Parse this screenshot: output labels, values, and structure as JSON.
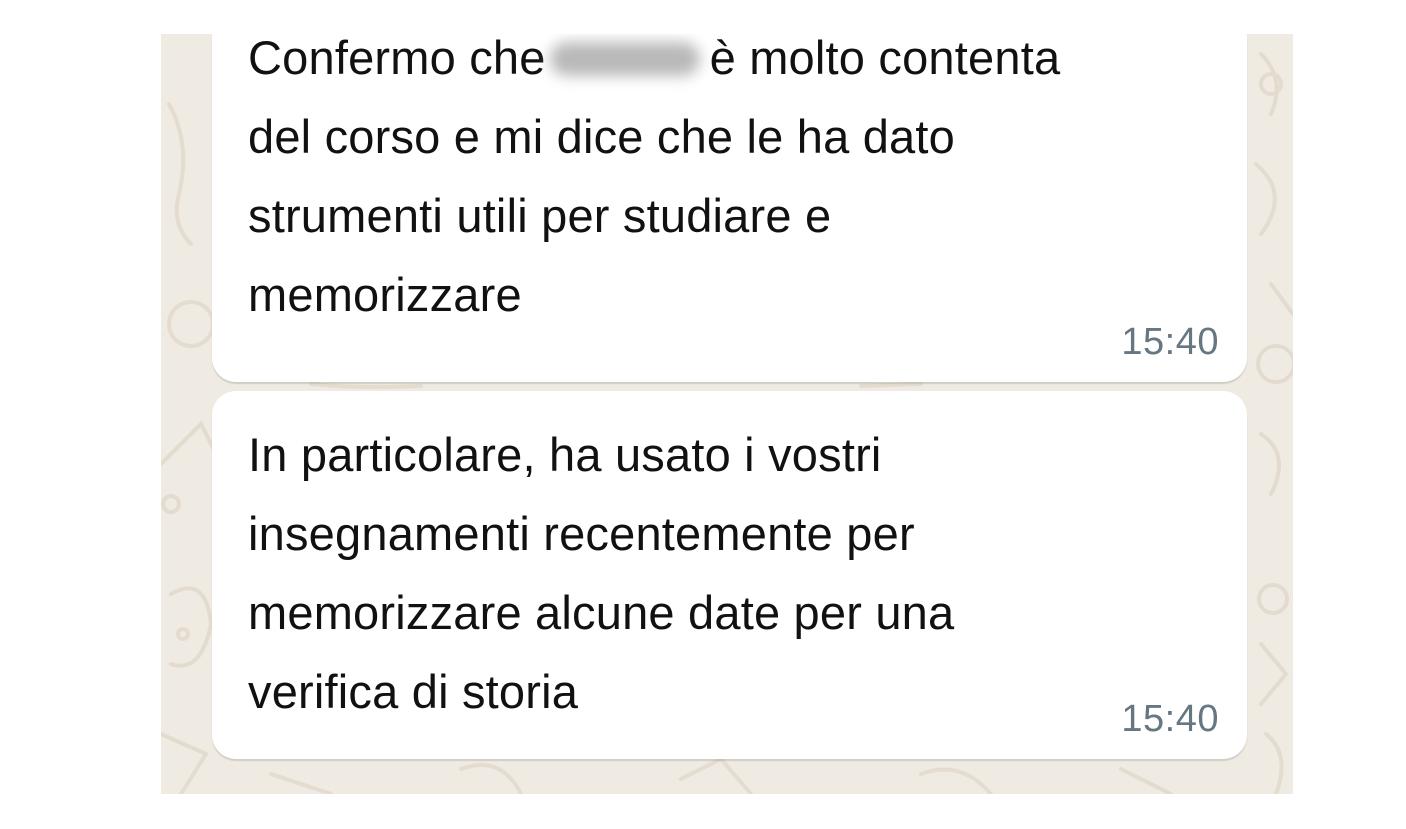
{
  "chat": {
    "background_color": "#efeae2",
    "bubble_color": "#ffffff",
    "messages": [
      {
        "text_before_redaction": "Confermo che",
        "text_after_redaction": "è molto contenta\ndel corso e mi dice che le ha dato\nstrumenti utili per studiare e\nmemorizzare",
        "time": "15:40"
      },
      {
        "text": "In particolare, ha usato i vostri\ninsegnamenti recentemente per\nmemorizzare alcune date per una\nverifica di storia",
        "time": "15:40"
      }
    ]
  }
}
